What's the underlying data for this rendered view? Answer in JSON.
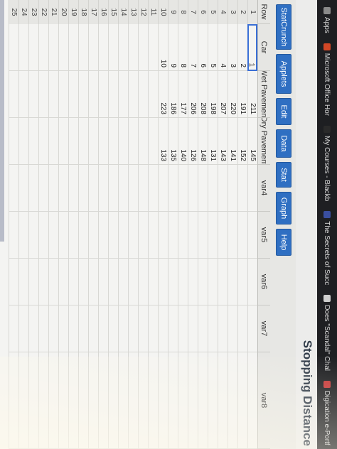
{
  "bookmarks": [
    {
      "label": "Apps",
      "icon": "apps-grid-icon",
      "color": "#8a8a8a"
    },
    {
      "label": "Microsoft Office Hor",
      "icon": "office-icon",
      "color": "#d24726"
    },
    {
      "label": "My Courses - Blackb",
      "icon": "blackboard-icon",
      "color": "#2a2a2a"
    },
    {
      "label": "The Secrets of Succ",
      "icon": "book-icon",
      "color": "#3a4fa0"
    },
    {
      "label": "Does \"Scandal\" Chal",
      "icon": "page-icon",
      "color": "#cfcfcf"
    },
    {
      "label": "Digication e-Portf",
      "icon": "digication-icon",
      "color": "#c73a3a"
    }
  ],
  "page_title": "Stopping Distance",
  "menu": [
    "StatCrunch",
    "Applets",
    "Edit",
    "Data",
    "Stat",
    "Graph",
    "Help"
  ],
  "columns": [
    "Row",
    "Car",
    "Wet Pavement",
    "Dry Pavement",
    "var4",
    "var5",
    "var6",
    "var7",
    "var8"
  ],
  "rows": [
    [
      "1",
      "1",
      "211",
      "145"
    ],
    [
      "2",
      "2",
      "191",
      "152"
    ],
    [
      "3",
      "3",
      "220",
      "141"
    ],
    [
      "4",
      "4",
      "207",
      "143"
    ],
    [
      "5",
      "5",
      "198",
      "131"
    ],
    [
      "6",
      "6",
      "208",
      "148"
    ],
    [
      "7",
      "7",
      "206",
      "126"
    ],
    [
      "8",
      "8",
      "177",
      "140"
    ],
    [
      "9",
      "9",
      "186",
      "135"
    ],
    [
      "10",
      "10",
      "223",
      "133"
    ],
    [
      "11",
      "",
      "",
      ""
    ],
    [
      "12",
      "",
      "",
      ""
    ],
    [
      "13",
      "",
      "",
      ""
    ],
    [
      "14",
      "",
      "",
      ""
    ],
    [
      "15",
      "",
      "",
      ""
    ],
    [
      "16",
      "",
      "",
      ""
    ],
    [
      "17",
      "",
      "",
      ""
    ],
    [
      "18",
      "",
      "",
      ""
    ],
    [
      "19",
      "",
      "",
      ""
    ],
    [
      "20",
      "",
      "",
      ""
    ],
    [
      "21",
      "",
      "",
      ""
    ],
    [
      "22",
      "",
      "",
      ""
    ],
    [
      "23",
      "",
      "",
      ""
    ],
    [
      "24",
      "",
      "",
      ""
    ],
    [
      "25",
      "",
      "",
      ""
    ]
  ]
}
